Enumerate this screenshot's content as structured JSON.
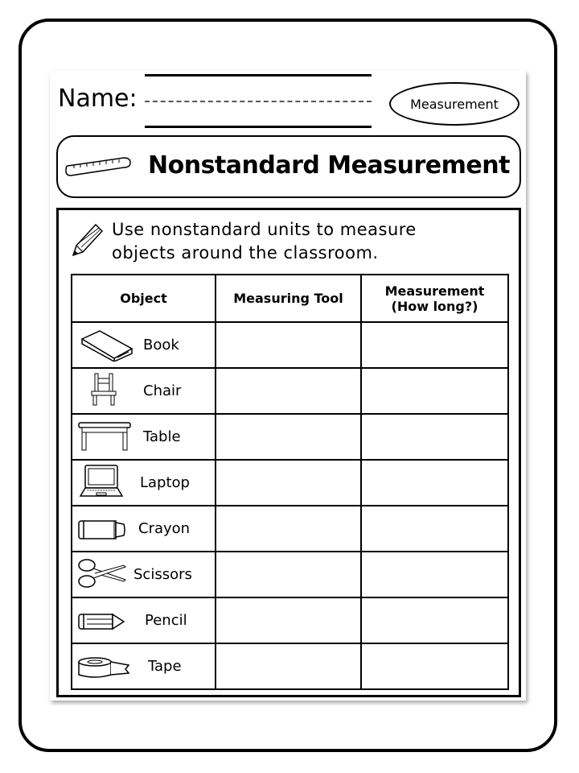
{
  "header": {
    "name_label": "Name:",
    "badge": "Measurement"
  },
  "title": "Nonstandard Measurement",
  "instructions": [
    "Use nonstandard units to measure",
    "objects around the classroom."
  ],
  "table": {
    "headers": [
      "Object",
      "Measuring Tool",
      "Measurement (How long?)"
    ],
    "header_line1": "Measurement",
    "header_line2": "(How long?)",
    "rows": [
      {
        "object": "Book",
        "icon": "book-icon",
        "tool": "",
        "measurement": ""
      },
      {
        "object": "Chair",
        "icon": "chair-icon",
        "tool": "",
        "measurement": ""
      },
      {
        "object": "Table",
        "icon": "table-icon",
        "tool": "",
        "measurement": ""
      },
      {
        "object": "Laptop",
        "icon": "laptop-icon",
        "tool": "",
        "measurement": ""
      },
      {
        "object": "Crayon",
        "icon": "crayon-icon",
        "tool": "",
        "measurement": ""
      },
      {
        "object": "Scissors",
        "icon": "scissors-icon",
        "tool": "",
        "measurement": ""
      },
      {
        "object": "Pencil",
        "icon": "pencil-icon",
        "tool": "",
        "measurement": ""
      },
      {
        "object": "Tape",
        "icon": "tape-icon",
        "tool": "",
        "measurement": ""
      }
    ]
  }
}
